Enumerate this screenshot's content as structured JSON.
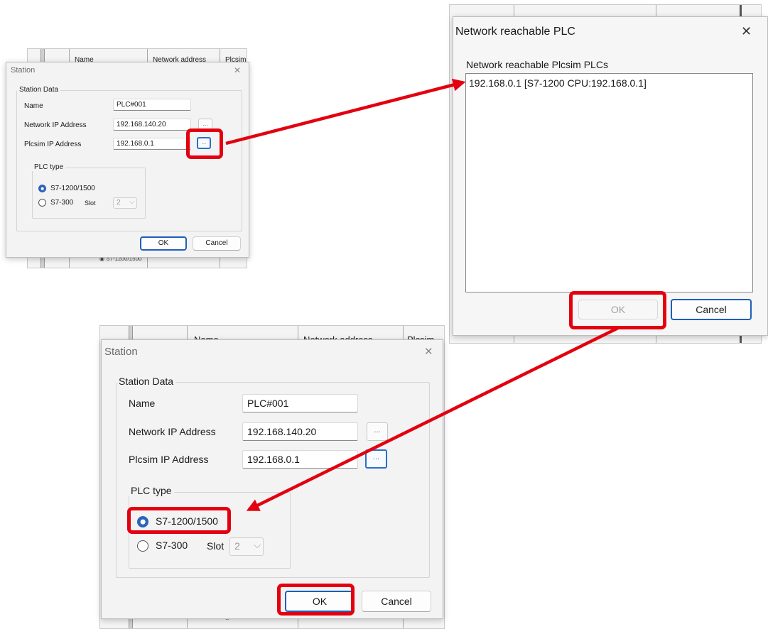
{
  "background": {
    "col_name": "Name",
    "col_network": "Network address",
    "col_plcsim": "Plcsim",
    "footer_radio": "S7-1200/1500"
  },
  "station": {
    "title": "Station",
    "close_glyph": "✕",
    "group_label": "Station Data",
    "name_label": "Name",
    "name_value": "PLC#001",
    "network_ip_label": "Network IP Address",
    "network_ip_value": "192.168.140.20",
    "plcsim_ip_label": "Plcsim IP Address",
    "plcsim_ip_value": "192.168.0.1",
    "browse_label": "...",
    "plc_type_label": "PLC type",
    "option_1200": "S7-1200/1500",
    "option_300": "S7-300",
    "slot_label": "Slot",
    "slot_value": "2",
    "chevron": "⌵",
    "ok_label": "OK",
    "cancel_label": "Cancel"
  },
  "network_dialog": {
    "title": "Network reachable PLC",
    "close_glyph": "✕",
    "list_label": "Network reachable Plcsim PLCs",
    "items": [
      "192.168.0.1 [S7-1200 CPU:192.168.0.1]"
    ],
    "ok_label": "OK",
    "cancel_label": "Cancel"
  },
  "colors": {
    "highlight": "#e3000f",
    "accent": "#2c64ba"
  }
}
